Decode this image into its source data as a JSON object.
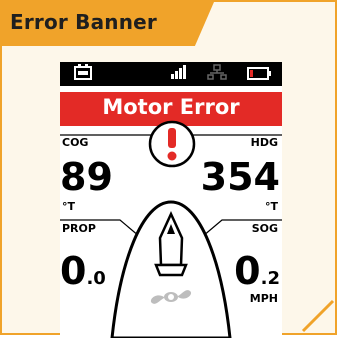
{
  "header": {
    "title": "Error Banner"
  },
  "banner": {
    "text": "Motor Error"
  },
  "cog": {
    "label": "COG",
    "value": "89",
    "unit": "°T"
  },
  "hdg": {
    "label": "HDG",
    "value": "354",
    "unit": "°T"
  },
  "prop": {
    "label": "PROP",
    "value_int": "0",
    "value_dec": ".0"
  },
  "sog": {
    "label": "SOG",
    "value_int": "0",
    "value_dec": ".2",
    "unit": "MPH"
  },
  "status_icons": [
    "battery-icon",
    "signal-icon",
    "network-icon",
    "battery-low-icon"
  ],
  "colors": {
    "accent": "#f0a32a",
    "error": "#e32a26"
  }
}
